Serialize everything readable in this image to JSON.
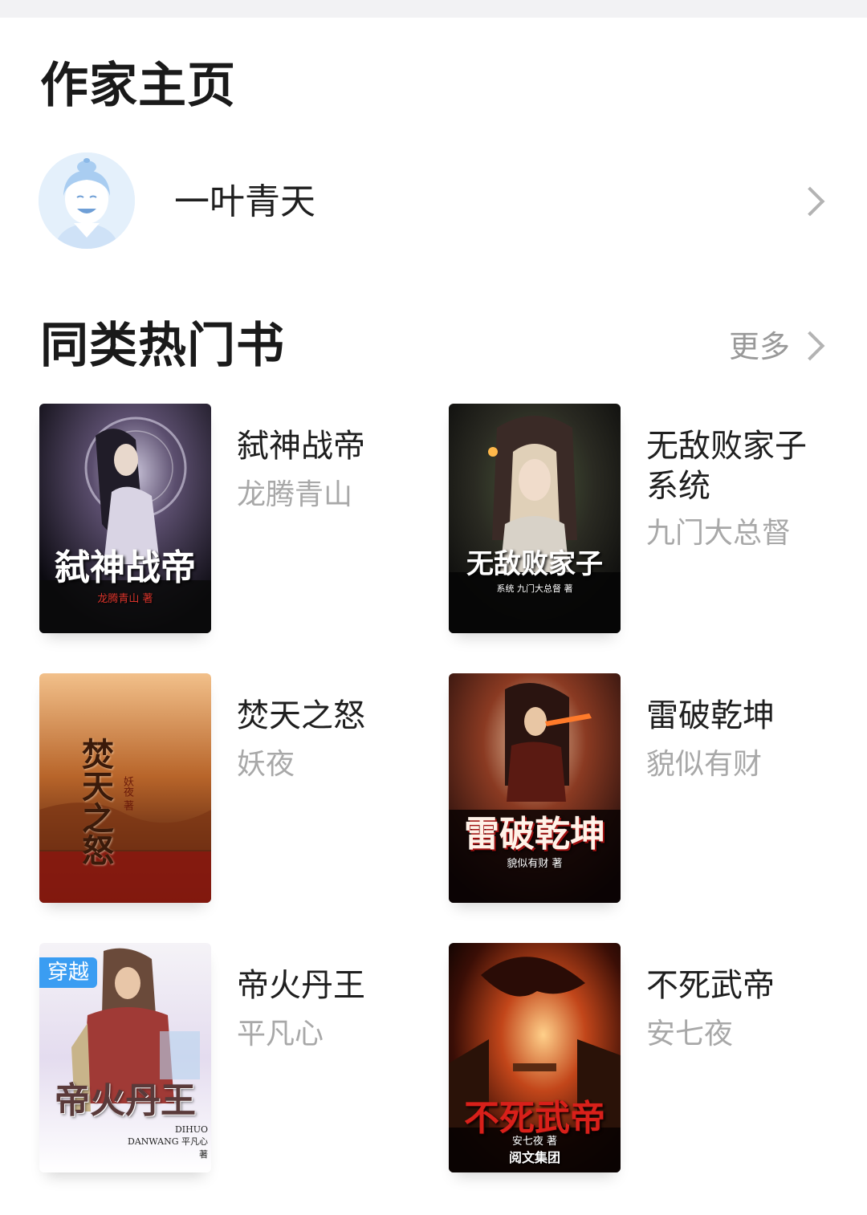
{
  "author_section": {
    "title": "作家主页",
    "author_name": "一叶青天",
    "avatar_icon": "avatar-illustration"
  },
  "hot_books": {
    "title": "同类热门书",
    "more_label": "更多",
    "books": [
      {
        "title": "弑神战帝",
        "author": "龙腾青山",
        "cover_title": "弑神战帝",
        "cover_author": "龙腾青山 著",
        "cover_tag": "",
        "cover_publisher": ""
      },
      {
        "title": "无敌败家子系统",
        "author": "九门大总督",
        "cover_title": "无敌败家子",
        "cover_author": "系统  九门大总督 著",
        "cover_tag": "",
        "cover_publisher": ""
      },
      {
        "title": "焚天之怒",
        "author": "妖夜",
        "cover_title": "焚天之怒",
        "cover_author": "妖夜 著",
        "cover_tag": "",
        "cover_publisher": ""
      },
      {
        "title": "雷破乾坤",
        "author": "貌似有财",
        "cover_title": "雷破乾坤",
        "cover_author": "貌似有财 著",
        "cover_tag": "",
        "cover_publisher": ""
      },
      {
        "title": "帝火丹王",
        "author": "平凡心",
        "cover_title": "帝火丹王",
        "cover_author": "DIHUO DANWANG 平凡心 著",
        "cover_tag": "穿越",
        "cover_publisher": ""
      },
      {
        "title": "不死武帝",
        "author": "安七夜",
        "cover_title": "不死武帝",
        "cover_author": "安七夜 著",
        "cover_tag": "",
        "cover_publisher": "阅文集团"
      }
    ]
  },
  "colors": {
    "background": "#ffffff",
    "title": "#1a1a1a",
    "secondary_text": "#a8a8a8",
    "tag": "#3a9df2"
  }
}
